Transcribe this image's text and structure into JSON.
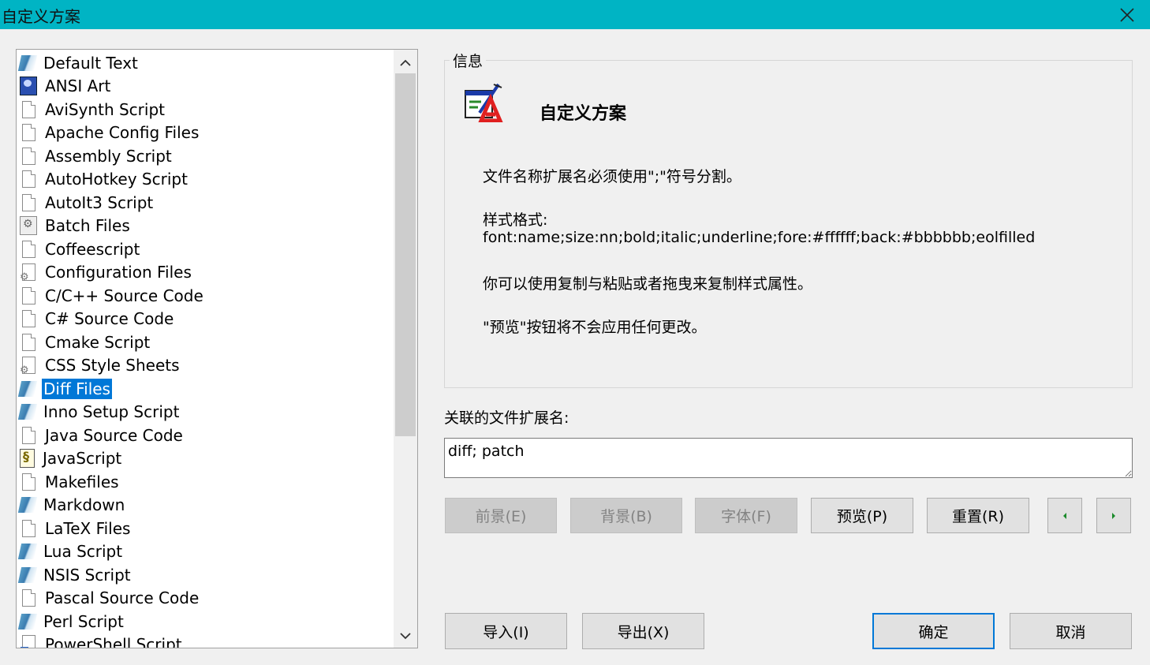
{
  "window": {
    "title": "自定义方案",
    "close_icon": "close-icon"
  },
  "scheme_list": {
    "selected_index": 14,
    "items": [
      {
        "label": "Default Text",
        "icon": "book-icon"
      },
      {
        "label": "ANSI Art",
        "icon": "ansi-art-icon"
      },
      {
        "label": "AviSynth Script",
        "icon": "document-icon"
      },
      {
        "label": "Apache Config Files",
        "icon": "document-icon"
      },
      {
        "label": "Assembly Script",
        "icon": "document-icon"
      },
      {
        "label": "AutoHotkey Script",
        "icon": "document-icon"
      },
      {
        "label": "AutoIt3 Script",
        "icon": "document-icon"
      },
      {
        "label": "Batch Files",
        "icon": "batch-file-icon"
      },
      {
        "label": "Coffeescript",
        "icon": "document-icon"
      },
      {
        "label": "Configuration Files",
        "icon": "config-file-icon"
      },
      {
        "label": "C/C++ Source Code",
        "icon": "document-icon"
      },
      {
        "label": "C# Source Code",
        "icon": "document-icon"
      },
      {
        "label": "Cmake Script",
        "icon": "document-icon"
      },
      {
        "label": "CSS Style Sheets",
        "icon": "config-file-icon"
      },
      {
        "label": "Diff Files",
        "icon": "book-icon"
      },
      {
        "label": "Inno Setup Script",
        "icon": "book-icon"
      },
      {
        "label": "Java Source Code",
        "icon": "document-icon"
      },
      {
        "label": "JavaScript",
        "icon": "javascript-file-icon"
      },
      {
        "label": "Makefiles",
        "icon": "document-icon"
      },
      {
        "label": "Markdown",
        "icon": "book-icon"
      },
      {
        "label": "LaTeX Files",
        "icon": "document-icon"
      },
      {
        "label": "Lua Script",
        "icon": "book-icon"
      },
      {
        "label": "NSIS Script",
        "icon": "book-icon"
      },
      {
        "label": "Pascal Source Code",
        "icon": "document-icon"
      },
      {
        "label": "Perl Script",
        "icon": "book-icon"
      },
      {
        "label": "PowerShell Script",
        "icon": "powershell-file-icon"
      }
    ]
  },
  "info": {
    "legend": "信息",
    "icon": "scheme-edit-icon",
    "title": "自定义方案",
    "line1": "文件名称扩展名必须使用\";\"符号分割。",
    "line2": "样式格式:",
    "line3": "font:name;size:nn;bold;italic;underline;fore:#ffffff;back:#bbbbbb;eolfilled",
    "line4": "你可以使用复制与粘贴或者拖曳来复制样式属性。",
    "line5": "\"预览\"按钮将不会应用任何更改。"
  },
  "extensions": {
    "label": "关联的文件扩展名:",
    "value": "diff; patch"
  },
  "buttons": {
    "foreground": "前景(E)",
    "background": "背景(B)",
    "font": "字体(F)",
    "preview": "预览(P)",
    "reset": "重置(R)",
    "prev_icon": "arrow-left-icon",
    "next_icon": "arrow-right-icon",
    "import": "导入(I)",
    "export": "导出(X)",
    "ok": "确定",
    "cancel": "取消"
  },
  "colors": {
    "titlebar": "#00b4c4",
    "selection": "#0078d7",
    "arrow_green": "#1a8a2a"
  }
}
